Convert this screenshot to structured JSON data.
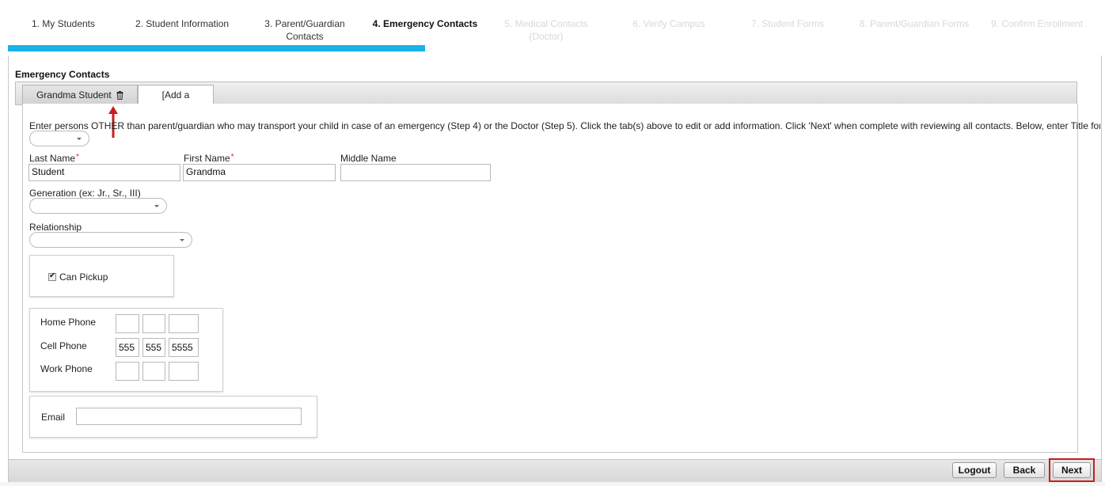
{
  "steps": [
    {
      "label": "1. My Students",
      "state": "done"
    },
    {
      "label": "2. Student Information",
      "state": "done"
    },
    {
      "label": "3. Parent/Guardian Contacts",
      "state": "done"
    },
    {
      "label": "4. Emergency Contacts",
      "state": "current"
    },
    {
      "label": "5. Medical Contacts (Doctor)",
      "state": "future"
    },
    {
      "label": "6. Verify Campus",
      "state": "future"
    },
    {
      "label": "7. Student Forms",
      "state": "future"
    },
    {
      "label": "8. Parent/Guardian Forms",
      "state": "future"
    },
    {
      "label": "9. Confirm Enrollment",
      "state": "future"
    }
  ],
  "progress_fraction": 0.38,
  "colors": {
    "progress": "#1ab2e8",
    "highlight": "#c81e1e",
    "required": "#dd2222"
  },
  "section": {
    "title": "Emergency Contacts"
  },
  "tabs": {
    "active_label": "Grandma Student",
    "active_icon": "trash-icon",
    "add_label": "[Add a Contact]"
  },
  "instructions": "Enter persons OTHER than parent/guardian who may transport your child in case of an emergency (Step 4) or the Doctor (Step 5). Click the tab(s) above to edit or add information. Click 'Next' when complete with reviewing all contacts. Below, enter Title for conta",
  "form": {
    "title_select_value": "",
    "last_name_label": "Last Name",
    "last_name_value": "Student",
    "first_name_label": "First Name",
    "first_name_value": "Grandma",
    "middle_name_label": "Middle Name",
    "middle_name_value": "",
    "generation_label": "Generation (ex: Jr., Sr., III)",
    "generation_value": "",
    "relationship_label": "Relationship",
    "relationship_value": "",
    "can_pickup_label": "Can Pickup",
    "can_pickup_checked": true,
    "home_phone_label": "Home Phone",
    "home_phone": [
      "",
      "",
      ""
    ],
    "cell_phone_label": "Cell Phone",
    "cell_phone": [
      "555",
      "555",
      "5555"
    ],
    "work_phone_label": "Work Phone",
    "work_phone": [
      "",
      "",
      ""
    ],
    "email_label": "Email",
    "email_value": ""
  },
  "footer": {
    "logout_label": "Logout",
    "back_label": "Back",
    "next_label": "Next"
  }
}
